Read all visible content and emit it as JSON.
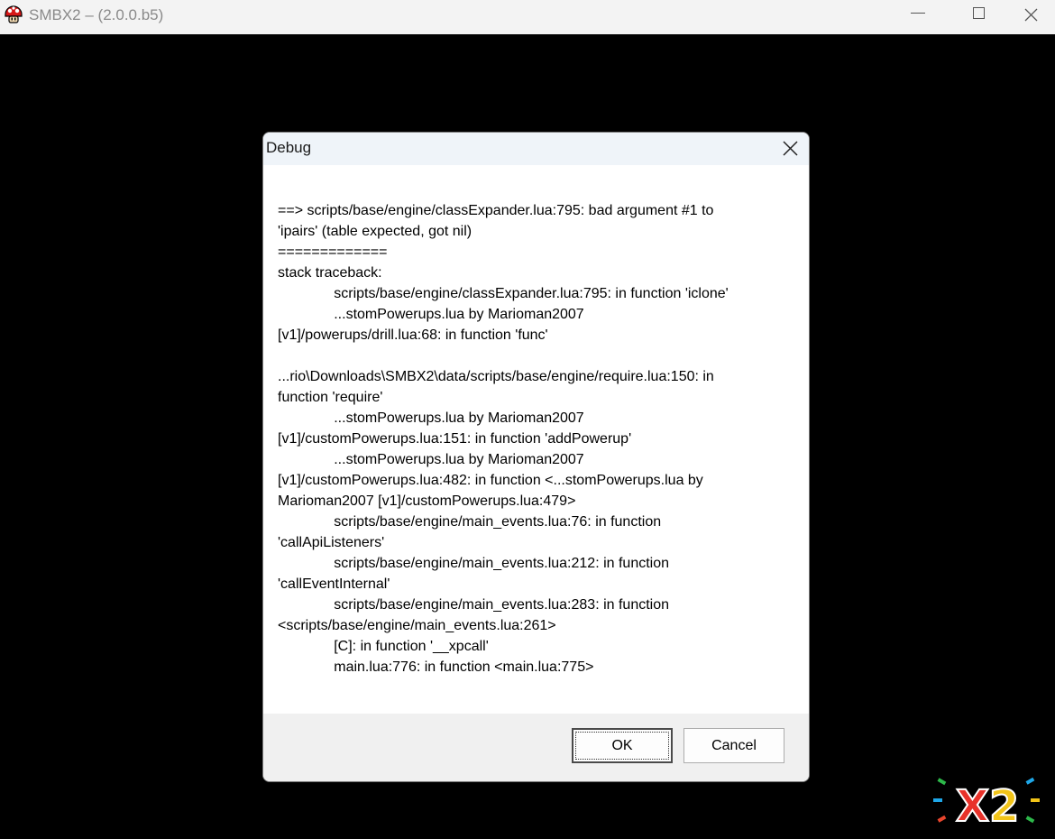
{
  "window": {
    "title": "SMBX2 – (2.0.0.b5)",
    "icon": "mushroom-icon",
    "controls": [
      "minimize-icon",
      "maximize-icon",
      "close-icon"
    ]
  },
  "dialog": {
    "title": "Debug",
    "message": "==> scripts/base/engine/classExpander.lua:795: bad argument #1 to\n'ipairs' (table expected, got nil)\n=============\nstack traceback:\n              scripts/base/engine/classExpander.lua:795: in function 'iclone'\n              ...stomPowerups.lua by Marioman2007\n[v1]/powerups/drill.lua:68: in function 'func'\n\n...rio\\Downloads\\SMBX2\\data/scripts/base/engine/require.lua:150: in\nfunction 'require'\n              ...stomPowerups.lua by Marioman2007\n[v1]/customPowerups.lua:151: in function 'addPowerup'\n              ...stomPowerups.lua by Marioman2007\n[v1]/customPowerups.lua:482: in function <...stomPowerups.lua by\nMarioman2007 [v1]/customPowerups.lua:479>\n              scripts/base/engine/main_events.lua:76: in function\n'callApiListeners'\n              scripts/base/engine/main_events.lua:212: in function\n'callEventInternal'\n              scripts/base/engine/main_events.lua:283: in function\n<scripts/base/engine/main_events.lua:261>\n              [C]: in function '__xpcall'\n              main.lua:776: in function <main.lua:775>",
    "ok_label": "OK",
    "cancel_label": "Cancel"
  },
  "logo": {
    "text": "X2"
  }
}
